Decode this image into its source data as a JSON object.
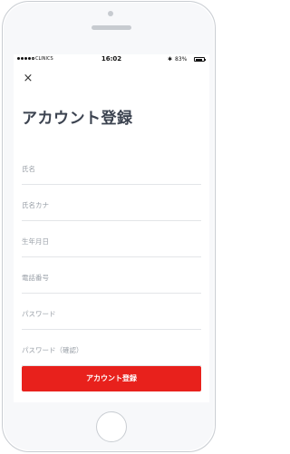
{
  "status_bar": {
    "carrier": "CLINICS",
    "time": "16:02",
    "battery_percent": "83%",
    "battery_level": 0.83,
    "bluetooth_icon": "bluetooth-icon"
  },
  "header": {
    "close_icon": "close-icon",
    "close_glyph": "×",
    "title": "アカウント登録"
  },
  "form": {
    "fields": [
      {
        "placeholder": "氏名",
        "value": ""
      },
      {
        "placeholder": "氏名カナ",
        "value": ""
      },
      {
        "placeholder": "生年月日",
        "value": ""
      },
      {
        "placeholder": "電話番号",
        "value": ""
      },
      {
        "placeholder": "パスワード",
        "value": ""
      },
      {
        "placeholder": "パスワード（確認）",
        "value": ""
      }
    ],
    "submit_label": "アカウント登録"
  },
  "colors": {
    "accent": "#e8211c",
    "title_text": "#3c4350",
    "placeholder_text": "#9aa0a8",
    "divider": "#e3e5e8"
  }
}
